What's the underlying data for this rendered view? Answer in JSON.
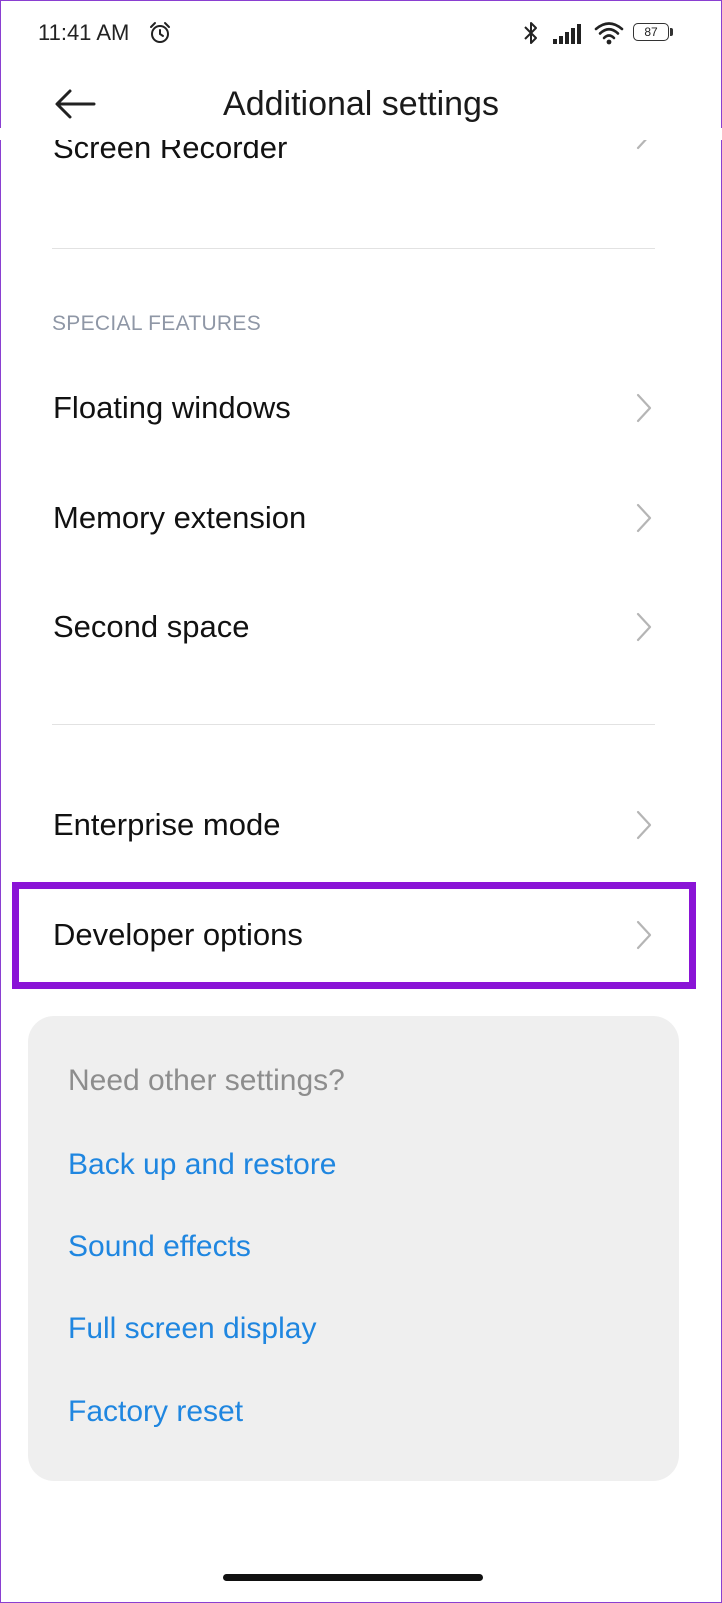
{
  "status_bar": {
    "time": "11:41 AM",
    "battery": "87",
    "icons": [
      "alarm-icon",
      "bluetooth-icon",
      "signal-icon",
      "wifi-icon",
      "battery-icon"
    ]
  },
  "header": {
    "title": "Additional settings",
    "back_icon": "back-arrow-icon"
  },
  "clipped_item": {
    "label": "Screen Recorder"
  },
  "special_features": {
    "header": "SPECIAL FEATURES",
    "items": [
      {
        "label": "Floating windows"
      },
      {
        "label": "Memory extension"
      },
      {
        "label": "Second space"
      }
    ]
  },
  "other_items": [
    {
      "label": "Enterprise mode"
    },
    {
      "label": "Developer options",
      "highlighted": true
    }
  ],
  "highlight_color": "#8a14d6",
  "suggestions": {
    "title": "Need other settings?",
    "links": [
      {
        "label": "Back up and restore"
      },
      {
        "label": "Sound effects"
      },
      {
        "label": "Full screen display"
      },
      {
        "label": "Factory reset"
      }
    ],
    "link_color": "#1f86e0"
  }
}
